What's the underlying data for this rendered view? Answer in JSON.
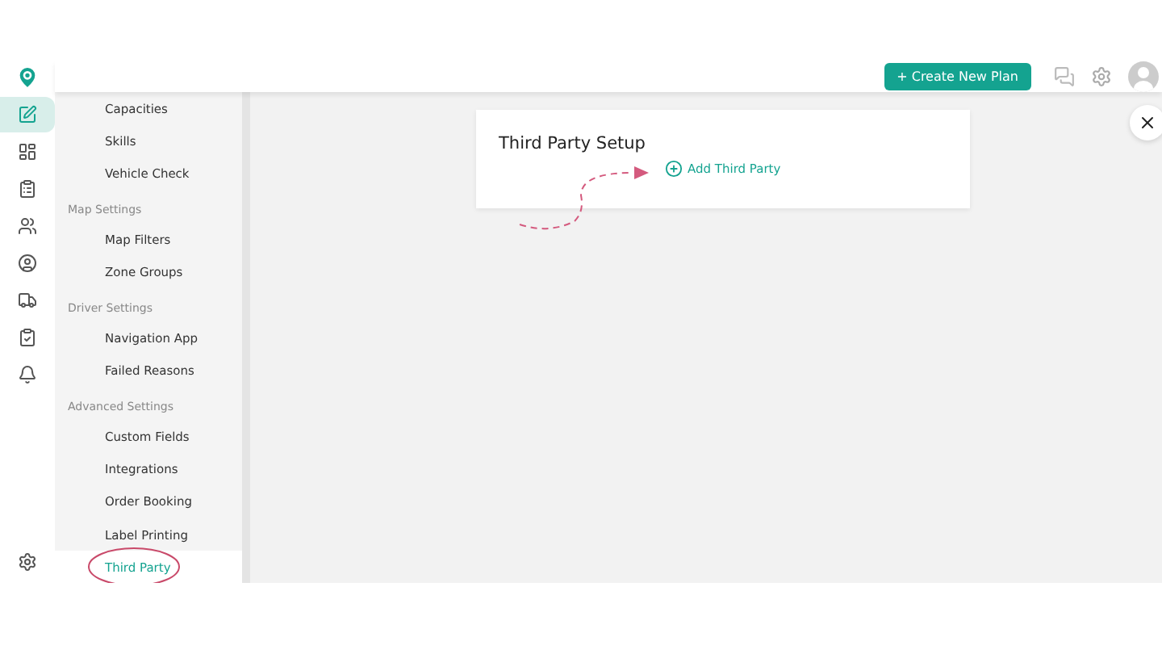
{
  "rail": {
    "items": [
      {
        "selected": true
      },
      {
        "selected": false
      },
      {
        "selected": false
      },
      {
        "selected": false
      },
      {
        "selected": false
      },
      {
        "selected": false
      },
      {
        "selected": false
      },
      {
        "selected": false
      }
    ]
  },
  "header": {
    "create_button": "+ Create New Plan"
  },
  "settings_nav": [
    {
      "kind": "item",
      "label": "Capacities",
      "selected": false
    },
    {
      "kind": "item",
      "label": "Skills",
      "selected": false
    },
    {
      "kind": "item",
      "label": "Vehicle Check",
      "selected": false
    },
    {
      "kind": "section",
      "label": "Map Settings"
    },
    {
      "kind": "item",
      "label": "Map Filters",
      "selected": false
    },
    {
      "kind": "item",
      "label": "Zone Groups",
      "selected": false
    },
    {
      "kind": "section",
      "label": "Driver Settings"
    },
    {
      "kind": "item",
      "label": "Navigation App",
      "selected": false
    },
    {
      "kind": "item",
      "label": "Failed Reasons",
      "selected": false
    },
    {
      "kind": "section",
      "label": "Advanced Settings"
    },
    {
      "kind": "item",
      "label": "Custom Fields",
      "selected": false
    },
    {
      "kind": "item",
      "label": "Integrations",
      "selected": false
    },
    {
      "kind": "item",
      "label": "Order Booking",
      "selected": false
    },
    {
      "kind": "item",
      "label": "Label Printing",
      "selected": false
    },
    {
      "kind": "item",
      "label": "Third Party",
      "selected": true
    }
  ],
  "card": {
    "title": "Third Party Setup",
    "add_link": "Add Third Party"
  }
}
